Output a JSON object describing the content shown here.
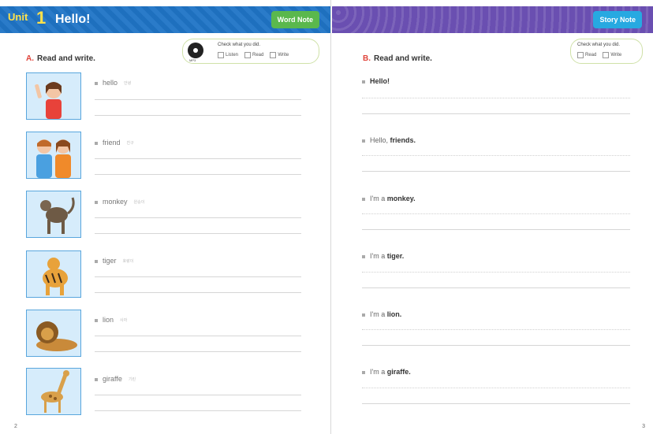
{
  "left_page": {
    "unit_label": "Unit",
    "unit_number": "1",
    "unit_title": "Hello!",
    "note_button": "Word Note",
    "check_title": "Check what you did.",
    "check_options": [
      "Listen",
      "Read",
      "Write"
    ],
    "audio_label": "MP3",
    "section_letter": "A.",
    "section_title": "Read and write.",
    "items": [
      {
        "word": "hello",
        "hint": "안녕",
        "picture": "girl-waving"
      },
      {
        "word": "friend",
        "hint": "친구",
        "picture": "two-friends"
      },
      {
        "word": "monkey",
        "hint": "원숭이",
        "picture": "monkey"
      },
      {
        "word": "tiger",
        "hint": "호랑이",
        "picture": "tiger"
      },
      {
        "word": "lion",
        "hint": "사자",
        "picture": "lion"
      },
      {
        "word": "giraffe",
        "hint": "기린",
        "picture": "giraffe"
      }
    ],
    "page_number": "2"
  },
  "right_page": {
    "note_button": "Story Note",
    "check_title": "Check what you did.",
    "check_options": [
      "Read",
      "Write"
    ],
    "section_letter": "B.",
    "section_title": "Read and write.",
    "sentences": [
      {
        "plain": "",
        "bold": "Hello!"
      },
      {
        "plain": "Hello, ",
        "bold": "friends."
      },
      {
        "plain": "I'm a ",
        "bold": "monkey."
      },
      {
        "plain": "I'm a ",
        "bold": "tiger."
      },
      {
        "plain": "I'm a ",
        "bold": "lion."
      },
      {
        "plain": "I'm a ",
        "bold": "giraffe."
      }
    ],
    "page_number": "3"
  }
}
